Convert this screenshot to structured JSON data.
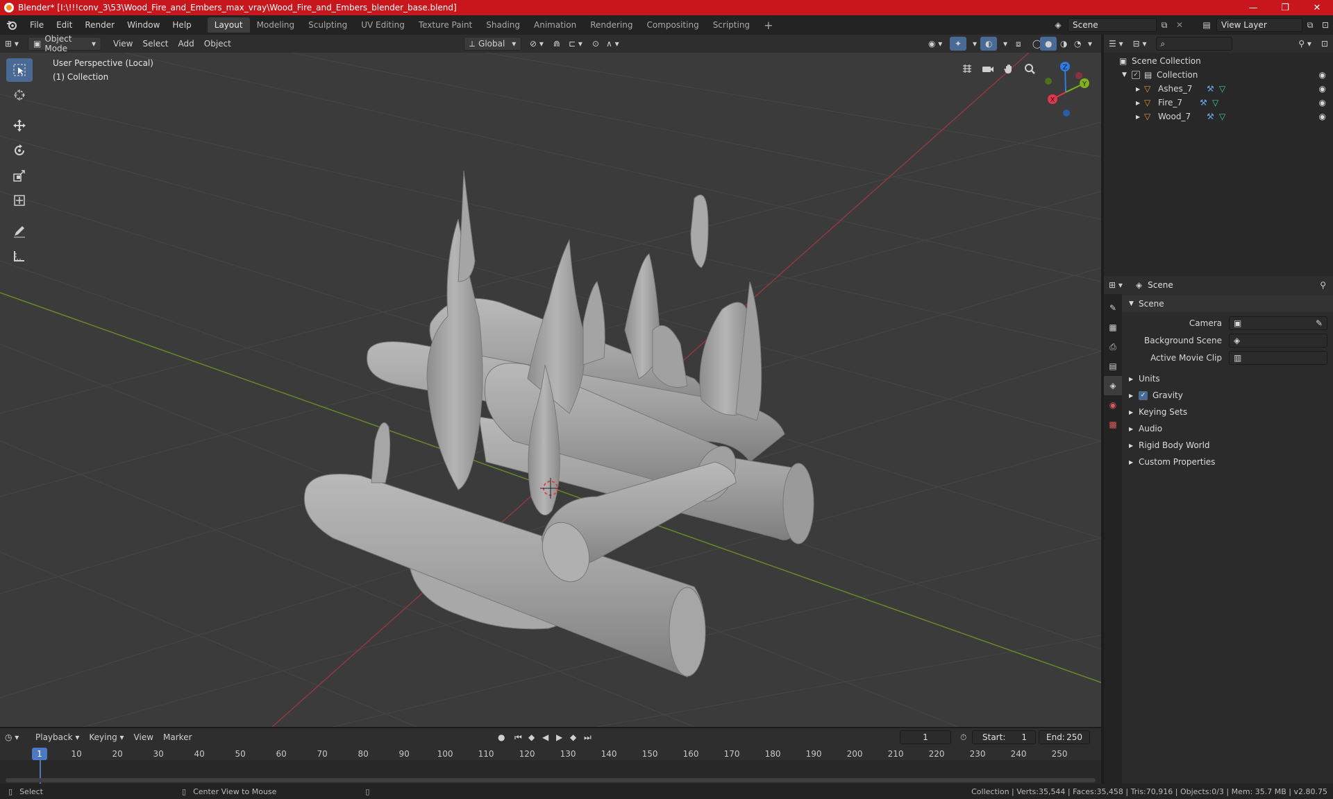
{
  "window": {
    "title": "Blender* [I:\\!!!conv_3\\53\\Wood_Fire_and_Embers_max_vray\\Wood_Fire_and_Embers_blender_base.blend]",
    "minimize": "—",
    "maximize": "❐",
    "close": "✕"
  },
  "menu": [
    "File",
    "Edit",
    "Render",
    "Window",
    "Help"
  ],
  "workspaces": [
    "Layout",
    "Modeling",
    "Sculpting",
    "UV Editing",
    "Texture Paint",
    "Shading",
    "Animation",
    "Rendering",
    "Compositing",
    "Scripting"
  ],
  "workspace_add": "+",
  "scene_field": "Scene",
  "view_layer_field": "View Layer",
  "viewport_header": {
    "mode": "Object Mode",
    "view": "View",
    "select": "Select",
    "add": "Add",
    "object": "Object",
    "orientation": "Global"
  },
  "viewport": {
    "perspective": "User Perspective (Local)",
    "collection": "(1) Collection",
    "gizmo_axes": {
      "x": "X",
      "y": "Y",
      "z": "Z"
    }
  },
  "outliner": {
    "root": "Scene Collection",
    "collection": "Collection",
    "objects": [
      "Ashes_7",
      "Fire_7",
      "Wood_7"
    ]
  },
  "properties": {
    "header": "Scene",
    "section": "Scene",
    "camera_label": "Camera",
    "background_label": "Background Scene",
    "movie_clip_label": "Active Movie Clip",
    "subsections": [
      "Units",
      "Gravity",
      "Keying Sets",
      "Audio",
      "Rigid Body World",
      "Custom Properties"
    ]
  },
  "timeline": {
    "menus": [
      "Playback",
      "Keying",
      "View",
      "Marker"
    ],
    "current_frame": "1",
    "start_label": "Start:",
    "start_value": "1",
    "end_label": "End:",
    "end_value": "250",
    "ticks": [
      "1",
      "10",
      "20",
      "30",
      "40",
      "50",
      "60",
      "70",
      "80",
      "90",
      "100",
      "110",
      "120",
      "130",
      "140",
      "150",
      "160",
      "170",
      "180",
      "190",
      "200",
      "210",
      "220",
      "230",
      "240",
      "250"
    ]
  },
  "statusbar": {
    "select": "Select",
    "center_view": "Center View to Mouse",
    "stats": "Collection | Verts:35,544 | Faces:35,458 | Tris:70,916 | Objects:0/3 | Mem: 35.7 MB | v2.80.75"
  },
  "colors": {
    "title_red": "#c8161d",
    "accent_blue": "#4a6a96",
    "frame_blue": "#4b7ac2",
    "axis_x": "#e0374a",
    "axis_y": "#7fb21e",
    "axis_z": "#2f7de0",
    "object_orange": "#e8923a",
    "modifier_blue": "#6aa7e8",
    "mesh_green": "#4ec7a1"
  }
}
